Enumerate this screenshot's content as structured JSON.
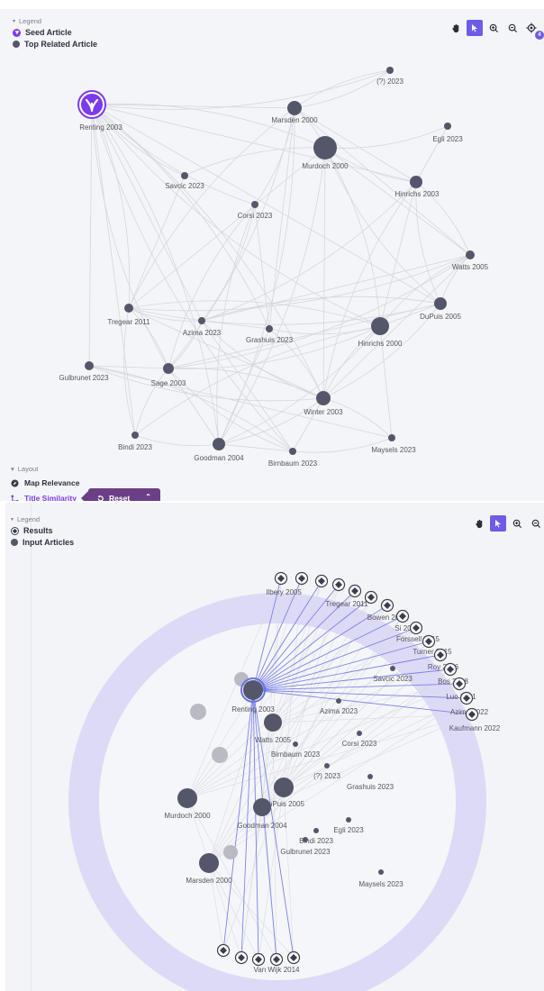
{
  "top_panel": {
    "legend": {
      "header": "Legend",
      "items": [
        {
          "label": "Seed Article",
          "icon": "seed-icon"
        },
        {
          "label": "Top Related Article",
          "icon": "dot-icon"
        }
      ]
    },
    "toolbar": {
      "tools": [
        {
          "name": "hand-pan-icon",
          "active": false
        },
        {
          "name": "pointer-select-icon",
          "active": true
        },
        {
          "name": "zoom-in-icon",
          "active": false
        },
        {
          "name": "zoom-out-icon",
          "active": false
        },
        {
          "name": "locate-icon",
          "active": false
        }
      ],
      "locate_badge": "4"
    },
    "layout": {
      "header": "Layout",
      "options": [
        {
          "label": "Map Relevance",
          "icon": "compass-icon",
          "selected": false
        },
        {
          "label": "Title Similarity",
          "icon": "similarity-icon",
          "selected": true
        }
      ],
      "reset_label": "Reset"
    },
    "nodes": [
      {
        "label": "Renting 2003",
        "seed": true
      },
      {
        "label": "(?) 2023"
      },
      {
        "label": "Marsden 2000"
      },
      {
        "label": "Egli 2023"
      },
      {
        "label": "Murdoch 2000"
      },
      {
        "label": "Savcic 2023"
      },
      {
        "label": "Hinrichs 2003"
      },
      {
        "label": "Corsi 2023"
      },
      {
        "label": "Watts 2005"
      },
      {
        "label": "DuPuis 2005"
      },
      {
        "label": "Tregear 2011"
      },
      {
        "label": "Azima 2023"
      },
      {
        "label": "Grashuis 2023"
      },
      {
        "label": "Hinrichs 2000"
      },
      {
        "label": "Gulbrunet 2023"
      },
      {
        "label": "Sage 2003"
      },
      {
        "label": "Winter 2003"
      },
      {
        "label": "Bindi 2023"
      },
      {
        "label": "Goodman 2004"
      },
      {
        "label": "Birnbaum 2023"
      },
      {
        "label": "Maysels 2023"
      }
    ]
  },
  "bottom_panel": {
    "legend": {
      "header": "Legend",
      "items": [
        {
          "label": "Results",
          "icon": "results-icon"
        },
        {
          "label": "Input Articles",
          "icon": "dot-icon"
        }
      ]
    },
    "toolbar": {
      "tools": [
        {
          "name": "hand-pan-icon",
          "active": false
        },
        {
          "name": "pointer-select-icon",
          "active": true
        },
        {
          "name": "zoom-in-icon",
          "active": false
        },
        {
          "name": "zoom-out-icon",
          "active": false
        }
      ]
    },
    "ring_labels": [
      "Ilbery 2005",
      "Tregear 2011",
      "Bowen 2014",
      "Si 2019",
      "Forssell 2015",
      "Turner 2015",
      "Roy 2016",
      "Bos 2018",
      "Luo 2021",
      "Azima 2022",
      "Kaufmann 2022",
      "Van Wijk 2014"
    ],
    "inner_labels": [
      "Savcic 2023",
      "Renting 2003",
      "Azima 2023",
      "Watts 2005",
      "Corsi 2023",
      "Birnbaum 2023",
      "(?) 2023",
      "Grashuis 2023",
      "DuPuis 2005",
      "Murdoch 2000",
      "Goodman 2004",
      "Egli 2023",
      "Bindi 2023",
      "Gulbrunet 2023",
      "Marsden 2000",
      "Maysels 2023"
    ]
  },
  "colors": {
    "accent": "#6d5ce8",
    "seed": "#7c3aed",
    "node": "#545769",
    "edge": "#d5d7de",
    "ring": "#dcdaf7",
    "blue_edge": "#6a73e6"
  }
}
